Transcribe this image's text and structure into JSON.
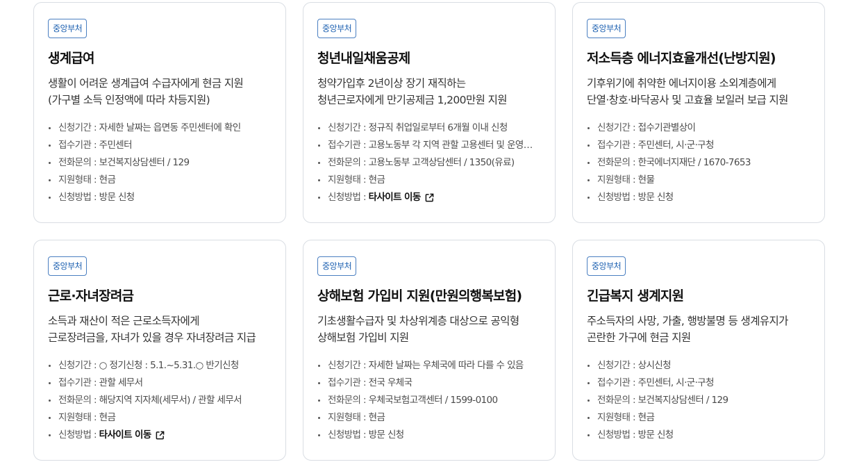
{
  "cards": [
    {
      "badge": "중앙부처",
      "title": "생계급여",
      "desc": [
        "생활이 어려운 생계급여 수급자에게 현금 지원",
        "(가구별 소득 인정액에 따라 차등지원)"
      ],
      "fields": {
        "period_label": "신청기간",
        "period": "자세한 날짜는 읍면동 주민센터에 확인",
        "agency_label": "접수기관",
        "agency": "주민센터",
        "contact_label": "전화문의",
        "contact": "보건복지상담센터 / 129",
        "type_label": "지원형태",
        "type": "현금",
        "method_label": "신청방법",
        "method": "방문 신청"
      }
    },
    {
      "badge": "중앙부처",
      "title": "청년내일채움공제",
      "desc": [
        "청약가입후 2년이상 장기 재직하는",
        "청년근로자에게 만기공제금 1,200만원 지원"
      ],
      "fields": {
        "period_label": "신청기간",
        "period": "정규직 취업일로부터 6개월 이내 신청",
        "agency_label": "접수기관",
        "agency": "고용노동부 각 지역 관할 고용센터 및 운영기관",
        "contact_label": "전화문의",
        "contact": "고용노동부 고객상담센터 / 1350(유료)",
        "type_label": "지원형태",
        "type": "현금",
        "method_label": "신청방법",
        "method": "타사이트 이동"
      }
    },
    {
      "badge": "중앙부처",
      "title": "저소득층 에너지효율개선(난방지원)",
      "desc": [
        "기후위기에 취약한 에너지이용 소외계층에게",
        "단열·창호·바닥공사 및 고효율 보일러 보급 지원"
      ],
      "fields": {
        "period_label": "신청기간",
        "period": "접수기관별상이",
        "agency_label": "접수기관",
        "agency": "주민센터, 시·군·구청",
        "contact_label": "전화문의",
        "contact": "한국에너지재단 / 1670-7653",
        "type_label": "지원형태",
        "type": "현물",
        "method_label": "신청방법",
        "method": "방문 신청"
      }
    },
    {
      "badge": "중앙부처",
      "title": "근로·자녀장려금",
      "desc": [
        "소득과 재산이 적은 근로소득자에게",
        "근로장려금을, 자녀가 있을 경우 자녀장려금 지급"
      ],
      "fields": {
        "period_label": "신청기간",
        "period": "○ 정기신청 : 5.1.~5.31.○ 반기신청",
        "agency_label": "접수기관",
        "agency": "관할 세무서",
        "contact_label": "전화문의",
        "contact": "해당지역 지자체(세무서) / 관할 세무서",
        "type_label": "지원형태",
        "type": "현금",
        "method_label": "신청방법",
        "method": "타사이트 이동"
      }
    },
    {
      "badge": "중앙부처",
      "title": "상해보험 가입비 지원(만원의행복보험)",
      "desc": [
        "기초생활수급자 및 차상위계층 대상으로 공익형",
        "상해보험 가입비 지원"
      ],
      "fields": {
        "period_label": "신청기간",
        "period": "자세한 날짜는 우체국에 따라 다를 수 있음",
        "agency_label": "접수기관",
        "agency": "전국 우체국",
        "contact_label": "전화문의",
        "contact": "우체국보험고객센터 / 1599-0100",
        "type_label": "지원형태",
        "type": "현금",
        "method_label": "신청방법",
        "method": "방문 신청"
      }
    },
    {
      "badge": "중앙부처",
      "title": "긴급복지 생계지원",
      "desc": [
        "주소득자의 사망, 가출, 행방불명 등 생계유지가",
        "곤란한 가구에 현금 지원"
      ],
      "fields": {
        "period_label": "신청기간",
        "period": "상시신청",
        "agency_label": "접수기관",
        "agency": "주민센터, 시·군·구청",
        "contact_label": "전화문의",
        "contact": "보건복지상담센터 / 129",
        "type_label": "지원형태",
        "type": "현금",
        "method_label": "신청방법",
        "method": "방문 신청"
      }
    }
  ],
  "colors": {
    "badge": "#1b5fb0",
    "border": "#d9dde3"
  },
  "icons": {
    "external_link": "external-link-icon"
  }
}
